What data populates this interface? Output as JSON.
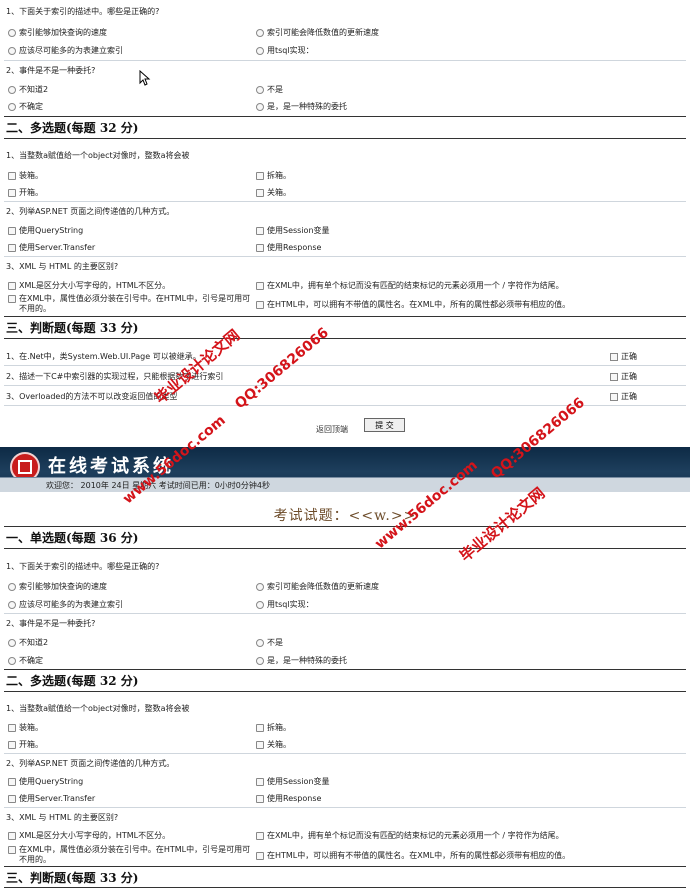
{
  "block1": {
    "q1": {
      "text": "1、下面关于索引的描述中。哪些是正确的?",
      "opts": [
        "索引能够加快查询的速度",
        "索引可能会降低数值的更新速度",
        "应该尽可能多的为表建立索引",
        "用tsql实现："
      ]
    },
    "q2": {
      "text": "2、事件是不是一种委托?",
      "opts": [
        "不知道2",
        "不是",
        "不确定",
        "是，是一种特殊的委托"
      ]
    }
  },
  "multi_section_title": "二、多选题(每题  32 分)",
  "multi": {
    "q1": {
      "text": "1、当整数a赋值给一个object对像时，整数a将会被",
      "opts": [
        "装箱。",
        "拆箱。",
        "开箱。",
        "关箱。"
      ]
    },
    "q2": {
      "text": "2、列举ASP.NET 页面之间传递值的几种方式。",
      "opts": [
        "使用QueryString",
        "使用Session变量",
        "使用Server.Transfer",
        "使用Response"
      ]
    },
    "q3": {
      "text": "3、XML 与 HTML 的主要区别?",
      "opts": [
        "XML是区分大小写字母的，HTML不区分。",
        "在XML中，拥有单个标记而没有匹配的结束标记的元素必须用一个 / 字符作为结尾。",
        "在XML中，属性值必须分装在引号中。在HTML中，引号是可用可不用的。",
        "在HTML中，可以拥有不带值的属性名。在XML中，所有的属性都必须带有相应的值。"
      ]
    }
  },
  "tf_section_title": "三、判断题(每题  33 分)",
  "tf": {
    "items": [
      "1、在.Net中，类System.Web.UI.Page 可以被继承。",
      "2、描述一下C#中索引器的实现过程，只能根据数字进行索引",
      "3、Overloaded的方法不可以改变返回值的类型"
    ],
    "correct_label": "正确"
  },
  "actions": {
    "back_top": "返回顶端",
    "submit": "提  交"
  },
  "banner": {
    "title": "在线考试系统",
    "welcome": "欢迎您：  2010年  24日  星期六    考试时间已用：0小时0分钟4秒"
  },
  "exam_title": "考试试题：<<w.>>",
  "single_section_title": "一、单选题(每题  36 分)",
  "block2": {
    "q1": {
      "text": "1、下面关于索引的描述中。哪些是正确的?",
      "opts": [
        "索引能够加快查询的速度",
        "索引可能会降低数值的更新速度",
        "应该尽可能多的为表建立索引",
        "用tsql实现："
      ]
    },
    "q2": {
      "text": "2、事件是不是一种委托?",
      "opts": [
        "不知道2",
        "不是",
        "不确定",
        "是，是一种特殊的委托"
      ]
    }
  },
  "multi_section_title_2": "二、多选题(每题  32 分)",
  "multi2": {
    "q1": {
      "text": "1、当整数a赋值给一个object对像时，整数a将会被",
      "opts": [
        "装箱。",
        "拆箱。",
        "开箱。",
        "关箱。"
      ]
    },
    "q2": {
      "text": "2、列举ASP.NET 页面之间传递值的几种方式。",
      "opts": [
        "使用QueryString",
        "使用Session变量",
        "使用Server.Transfer",
        "使用Response"
      ]
    },
    "q3": {
      "text": "3、XML 与 HTML 的主要区别?",
      "opts": [
        "XML是区分大小写字母的，HTML不区分。",
        "在XML中，拥有单个标记而没有匹配的结束标记的元素必须用一个 / 字符作为结尾。",
        "在XML中，属性值必须分装在引号中。在HTML中，引号是可用可不用的。",
        "在HTML中，可以拥有不带值的属性名。在XML中，所有的属性都必须带有相应的值。"
      ]
    }
  },
  "tf_section_title_2": "三、判断题(每题  33 分)",
  "watermarks": {
    "w1": "毕业设计论文网",
    "w2": "QQ:306826066",
    "w3": "www.56doc.com",
    "w4": "QQ:306826066",
    "w5": "www.56doc.com",
    "w6": "毕业设计论文网"
  },
  "colors": {
    "banner": "#1e3f5d",
    "watermark": "#d4141a",
    "exam_title": "#6d4c2a"
  }
}
